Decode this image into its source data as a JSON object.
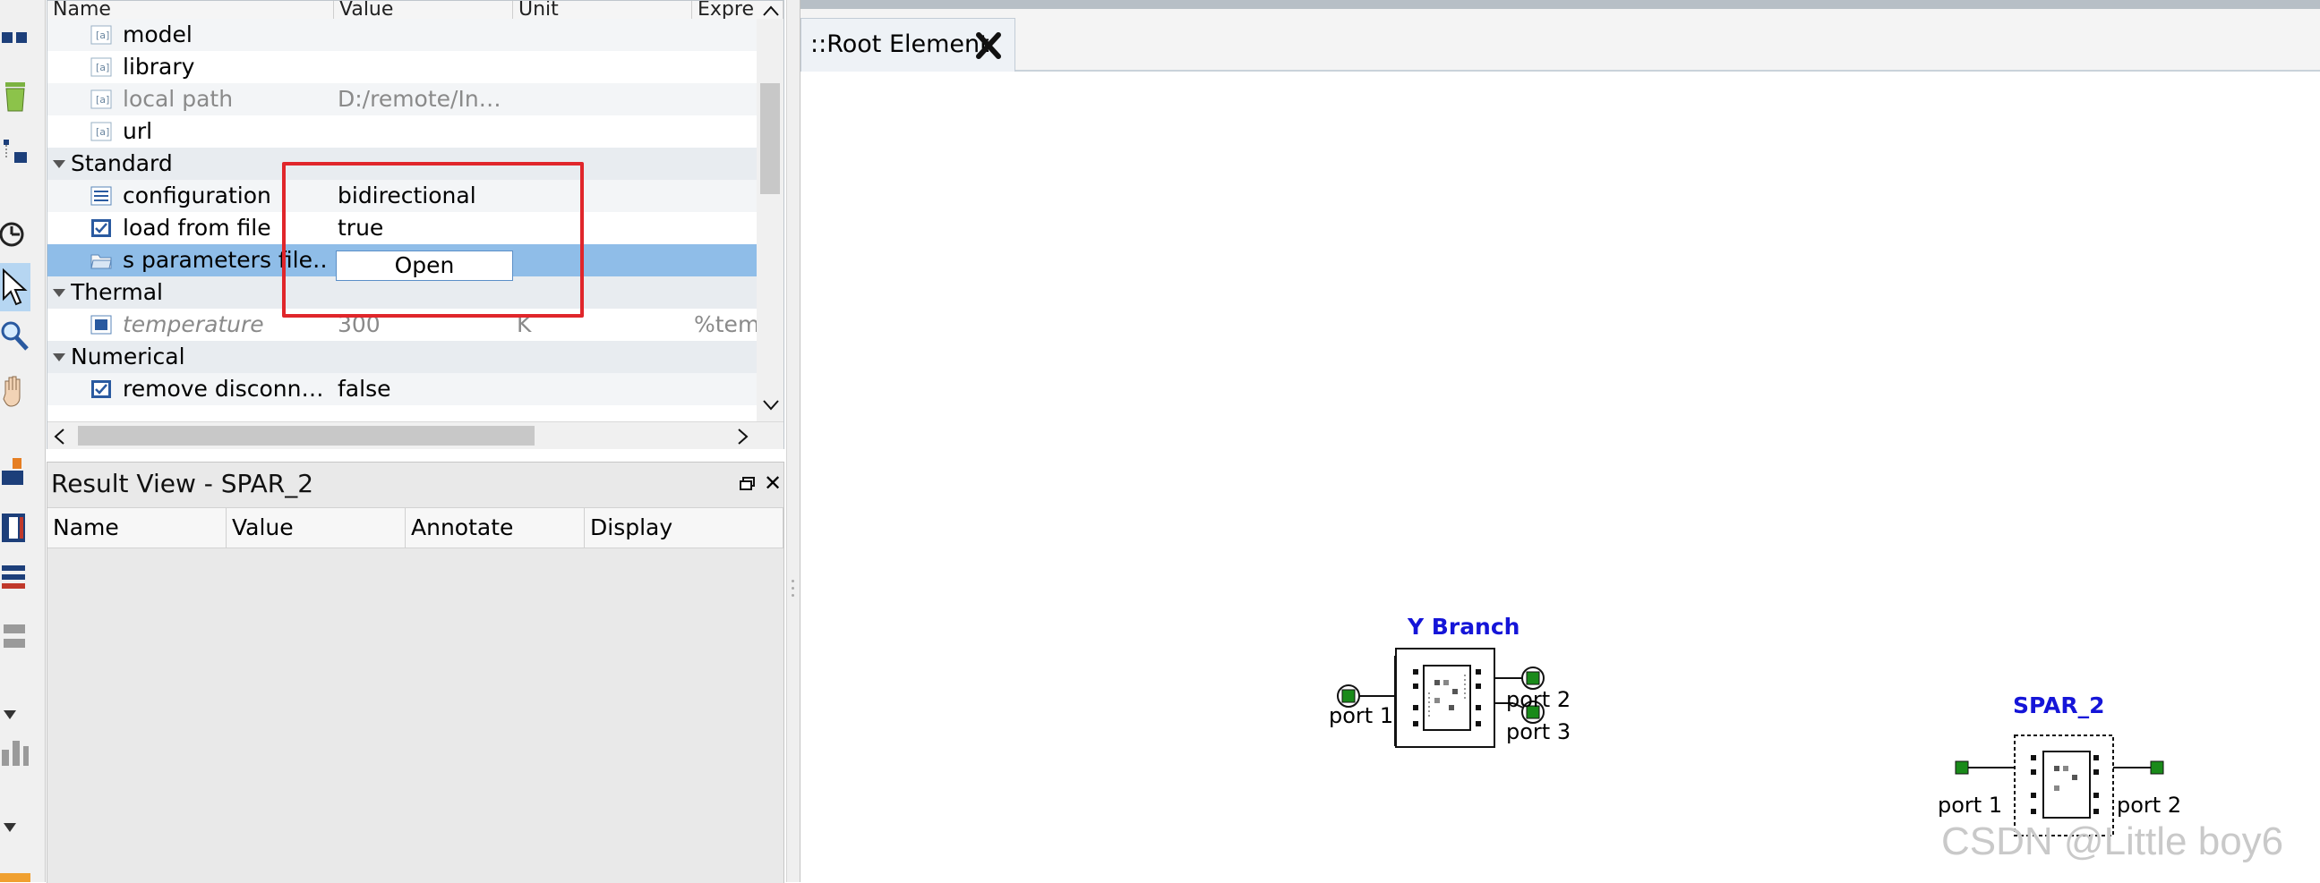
{
  "toolbar": {
    "icons": [
      "layout-icon",
      "trash-icon",
      "grid-icon",
      "clock-icon",
      "pointer-icon",
      "zoom-icon",
      "hand-icon",
      "rotate-icon",
      "film-icon",
      "align-icon",
      "stack-icon",
      "chevron-down-icon",
      "chart-icon",
      "chevron-down-icon"
    ]
  },
  "property_panel": {
    "columns": [
      "Name",
      "Value",
      "Unit",
      "Expre"
    ],
    "rows": [
      {
        "kind": "item",
        "name": "model",
        "value": "",
        "unit": "",
        "expr": "",
        "icon": "text-icon"
      },
      {
        "kind": "item",
        "name": "library",
        "value": "",
        "unit": "",
        "expr": "",
        "icon": "text-icon"
      },
      {
        "kind": "item",
        "name": "local path",
        "value": "D:/remote/In…",
        "unit": "",
        "expr": "",
        "icon": "text-icon",
        "greyed": true
      },
      {
        "kind": "item",
        "name": "url",
        "value": "",
        "unit": "",
        "expr": "",
        "icon": "text-icon"
      },
      {
        "kind": "section",
        "name": "Standard"
      },
      {
        "kind": "item",
        "name": "configuration",
        "value": "bidirectional",
        "unit": "",
        "expr": "",
        "icon": "list-icon"
      },
      {
        "kind": "item",
        "name": "load from file",
        "value": "true",
        "unit": "",
        "expr": "",
        "icon": "checkbox-icon"
      },
      {
        "kind": "item",
        "name": "s parameters file…",
        "value": "",
        "unit": "",
        "expr": "",
        "icon": "folder-icon",
        "selected": true
      },
      {
        "kind": "section",
        "name": "Thermal"
      },
      {
        "kind": "item",
        "name": "temperature",
        "value": "300",
        "unit": "K",
        "expr": "%tem",
        "icon": "square-icon",
        "greyed": true,
        "italic": true
      },
      {
        "kind": "section",
        "name": "Numerical"
      },
      {
        "kind": "item",
        "name": "remove disconn…",
        "value": "false",
        "unit": "",
        "expr": "",
        "icon": "checkbox-icon"
      }
    ],
    "open_button": "Open"
  },
  "result_view": {
    "title": "Result View - SPAR_2",
    "columns": [
      "Name",
      "Value",
      "Annotate",
      "Display"
    ]
  },
  "editor": {
    "tab_label": "::Root Element"
  },
  "schematic": {
    "components": [
      {
        "name": "Y Branch",
        "ports": [
          "port 1",
          "port 2",
          "port 3"
        ]
      },
      {
        "name": "SPAR_2",
        "ports": [
          "port 1",
          "port 2"
        ]
      }
    ]
  },
  "watermark": "CSDN @Little boy6",
  "colors": {
    "selection": "#8fbde8",
    "highlight_box": "#e0262b",
    "component_name": "#1515d8",
    "port_green": "#1a8a1a"
  }
}
